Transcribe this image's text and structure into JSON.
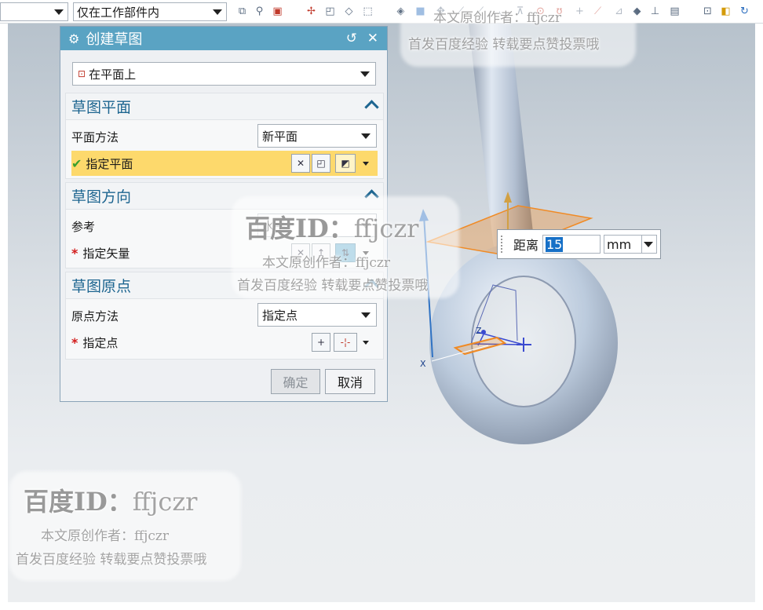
{
  "toolbar": {
    "scope_select_value": "仅在工作部件内"
  },
  "dialog": {
    "title": "创建草图",
    "type_select": "在平面上",
    "sections": {
      "plane": {
        "title": "草图平面",
        "method_label": "平面方法",
        "method_value": "新平面",
        "specify_label": "指定平面"
      },
      "orientation": {
        "title": "草图方向",
        "reference_label": "参考",
        "reference_value": "水平",
        "vector_label": "指定矢量"
      },
      "origin": {
        "title": "草图原点",
        "method_label": "原点方法",
        "method_value": "指定点",
        "point_label": "指定点"
      }
    },
    "ok_button": "确定",
    "cancel_button": "取消"
  },
  "distance_popup": {
    "label": "距离",
    "value": "15",
    "unit": "mm"
  },
  "axes": {
    "x_label": "X",
    "z_label": "Z"
  },
  "watermark": {
    "top_line": "本文原创作者：ffjczr",
    "top_line2": "首发百度经验 转载要点赞投票哦",
    "mid_brand": "百度ID：",
    "mid_id": "ffjczr",
    "mid_author": "本文原创作者：ffjczr",
    "mid_note": "首发百度经验 转载要点赞投票哦",
    "bottom_brand": "百度ID：",
    "bottom_id": "ffjczr",
    "bottom_author": "本文原创作者：ffjczr",
    "bottom_note": "首发百度经验 转载要点赞投票哦"
  },
  "colors": {
    "title_bar": "#5aa3c3",
    "section_heading": "#1d6590",
    "highlight_row": "#fdd96c",
    "ring": "#b9c9de",
    "plane": "#f08a24"
  }
}
